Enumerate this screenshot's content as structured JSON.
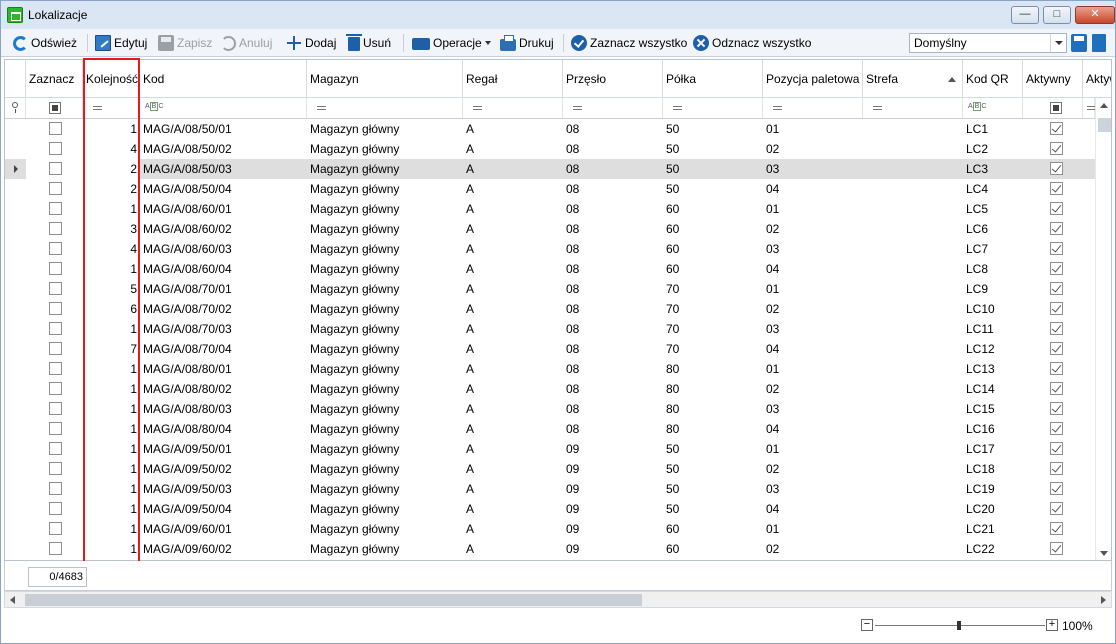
{
  "window": {
    "title": "Lokalizacje"
  },
  "toolbar": {
    "refresh": "Odśwież",
    "edit": "Edytuj",
    "save": "Zapisz",
    "cancel": "Anuluj",
    "add": "Dodaj",
    "delete": "Usuń",
    "operations": "Operacje",
    "print": "Drukuj",
    "select_all": "Zaznacz wszystko",
    "deselect_all": "Odznacz wszystko",
    "layout_value": "Domyślny"
  },
  "columns": {
    "zaznacz": "Zaznacz",
    "kolejnosc": "Kolejność",
    "kod": "Kod",
    "magazyn": "Magazyn",
    "regal": "Regał",
    "przeslo": "Przęsło",
    "polka": "Półka",
    "pozycja": "Pozycja paletowa",
    "strefa": "Strefa",
    "kodqr": "Kod QR",
    "aktywny": "Aktywny",
    "aktyw2": "Aktyw"
  },
  "rows": [
    {
      "k": "1",
      "kod": "MAG/A/08/50/01",
      "mag": "Magazyn główny",
      "reg": "A",
      "prz": "08",
      "pol": "50",
      "poz": "01",
      "qr": "LC1"
    },
    {
      "k": "4",
      "kod": "MAG/A/08/50/02",
      "mag": "Magazyn główny",
      "reg": "A",
      "prz": "08",
      "pol": "50",
      "poz": "02",
      "qr": "LC2"
    },
    {
      "k": "2",
      "kod": "MAG/A/08/50/03",
      "mag": "Magazyn główny",
      "reg": "A",
      "prz": "08",
      "pol": "50",
      "poz": "03",
      "qr": "LC3"
    },
    {
      "k": "2",
      "kod": "MAG/A/08/50/04",
      "mag": "Magazyn główny",
      "reg": "A",
      "prz": "08",
      "pol": "50",
      "poz": "04",
      "qr": "LC4"
    },
    {
      "k": "1",
      "kod": "MAG/A/08/60/01",
      "mag": "Magazyn główny",
      "reg": "A",
      "prz": "08",
      "pol": "60",
      "poz": "01",
      "qr": "LC5"
    },
    {
      "k": "3",
      "kod": "MAG/A/08/60/02",
      "mag": "Magazyn główny",
      "reg": "A",
      "prz": "08",
      "pol": "60",
      "poz": "02",
      "qr": "LC6"
    },
    {
      "k": "4",
      "kod": "MAG/A/08/60/03",
      "mag": "Magazyn główny",
      "reg": "A",
      "prz": "08",
      "pol": "60",
      "poz": "03",
      "qr": "LC7"
    },
    {
      "k": "1",
      "kod": "MAG/A/08/60/04",
      "mag": "Magazyn główny",
      "reg": "A",
      "prz": "08",
      "pol": "60",
      "poz": "04",
      "qr": "LC8"
    },
    {
      "k": "5",
      "kod": "MAG/A/08/70/01",
      "mag": "Magazyn główny",
      "reg": "A",
      "prz": "08",
      "pol": "70",
      "poz": "01",
      "qr": "LC9"
    },
    {
      "k": "6",
      "kod": "MAG/A/08/70/02",
      "mag": "Magazyn główny",
      "reg": "A",
      "prz": "08",
      "pol": "70",
      "poz": "02",
      "qr": "LC10"
    },
    {
      "k": "1",
      "kod": "MAG/A/08/70/03",
      "mag": "Magazyn główny",
      "reg": "A",
      "prz": "08",
      "pol": "70",
      "poz": "03",
      "qr": "LC11"
    },
    {
      "k": "7",
      "kod": "MAG/A/08/70/04",
      "mag": "Magazyn główny",
      "reg": "A",
      "prz": "08",
      "pol": "70",
      "poz": "04",
      "qr": "LC12"
    },
    {
      "k": "1",
      "kod": "MAG/A/08/80/01",
      "mag": "Magazyn główny",
      "reg": "A",
      "prz": "08",
      "pol": "80",
      "poz": "01",
      "qr": "LC13"
    },
    {
      "k": "1",
      "kod": "MAG/A/08/80/02",
      "mag": "Magazyn główny",
      "reg": "A",
      "prz": "08",
      "pol": "80",
      "poz": "02",
      "qr": "LC14"
    },
    {
      "k": "1",
      "kod": "MAG/A/08/80/03",
      "mag": "Magazyn główny",
      "reg": "A",
      "prz": "08",
      "pol": "80",
      "poz": "03",
      "qr": "LC15"
    },
    {
      "k": "1",
      "kod": "MAG/A/08/80/04",
      "mag": "Magazyn główny",
      "reg": "A",
      "prz": "08",
      "pol": "80",
      "poz": "04",
      "qr": "LC16"
    },
    {
      "k": "1",
      "kod": "MAG/A/09/50/01",
      "mag": "Magazyn główny",
      "reg": "A",
      "prz": "09",
      "pol": "50",
      "poz": "01",
      "qr": "LC17"
    },
    {
      "k": "1",
      "kod": "MAG/A/09/50/02",
      "mag": "Magazyn główny",
      "reg": "A",
      "prz": "09",
      "pol": "50",
      "poz": "02",
      "qr": "LC18"
    },
    {
      "k": "1",
      "kod": "MAG/A/09/50/03",
      "mag": "Magazyn główny",
      "reg": "A",
      "prz": "09",
      "pol": "50",
      "poz": "03",
      "qr": "LC19"
    },
    {
      "k": "1",
      "kod": "MAG/A/09/50/04",
      "mag": "Magazyn główny",
      "reg": "A",
      "prz": "09",
      "pol": "50",
      "poz": "04",
      "qr": "LC20"
    },
    {
      "k": "1",
      "kod": "MAG/A/09/60/01",
      "mag": "Magazyn główny",
      "reg": "A",
      "prz": "09",
      "pol": "60",
      "poz": "01",
      "qr": "LC21"
    },
    {
      "k": "1",
      "kod": "MAG/A/09/60/02",
      "mag": "Magazyn główny",
      "reg": "A",
      "prz": "09",
      "pol": "60",
      "poz": "02",
      "qr": "LC22"
    }
  ],
  "selected_row": 2,
  "footer": {
    "record_count": "0/4683"
  },
  "status": {
    "zoom": "100%",
    "zoom_minus": "−",
    "zoom_plus": "+"
  },
  "colors": {
    "highlight": "#e01c1c",
    "selected_row": "#dedede",
    "accent": "#1d5fa8"
  }
}
